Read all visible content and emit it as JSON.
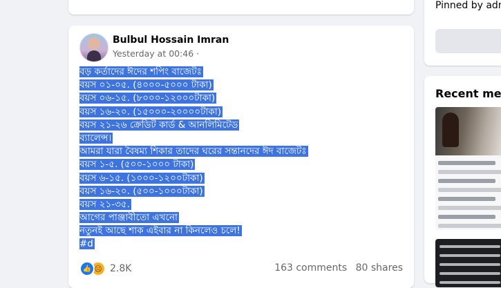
{
  "post": {
    "author": "Bulbul Hossain Imran",
    "meta": "Yesterday at 00:46 ·",
    "lines": [
      "বড় কর্তাদের ঈদের শপিং বাজেটঃ",
      "বয়স ০১-০৫. (৪০০০-৫০০০ টাকা)",
      "বয়স ০৬-১৫. (৮০০০-১২০০০টাকা)",
      "বয়স ১৬-২০. (১৫০০০-২০০০০টাকা)",
      "বয়স ২১-২৬ ক্রেডিট কার্ড & আনলিমিটেড",
      "ব্যালেন্স।",
      "আমরা যারা বৈষম্য শিকার তাদের  ঘরের সন্তানদের ঈদ বাজেটঃ",
      "বয়স  ১-৫.  (৫০০-১০০০ টাকা)",
      "বয়স ৬-১৫. (১০০০-১২০০টাকা)",
      "বয়স ১৬-২০. (৫০০-১০০০টাকা)",
      "বয়স ২১-৩৫.",
      "আগের পাঞ্জাবীতো এখনো",
      "নতুনই আছে শাক এইবার না কিনলেও চলে!",
      "#d"
    ],
    "reactions": {
      "like_icon": "like-icon",
      "sad_icon": "sad-icon",
      "count": "2.8K"
    },
    "comments": "163 comments",
    "shares": "80 shares",
    "selection_color": "#3e74e0"
  },
  "sidebar": {
    "pinned_label": "Pinned by adm",
    "media_title": "Recent medi"
  }
}
